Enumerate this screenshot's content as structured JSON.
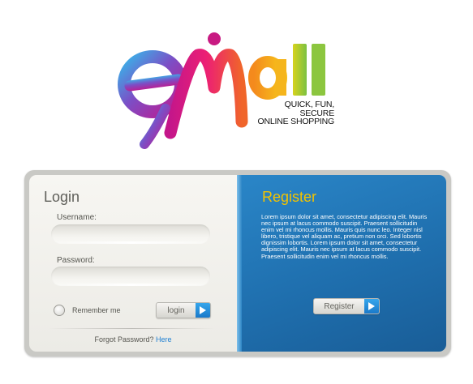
{
  "brand": {
    "logo_text": "emall",
    "tagline": [
      "QUICK, FUN,",
      "SECURE",
      "ONLINE SHOPPING"
    ]
  },
  "login": {
    "title": "Login",
    "username_label": "Username:",
    "username_value": "",
    "password_label": "Password:",
    "password_value": "",
    "remember_label": "Remember me",
    "remember_checked": false,
    "button_label": "login",
    "forgot_text": "Forgot Password?",
    "forgot_link": "Here"
  },
  "register": {
    "title": "Register",
    "description": "Lorem ipsum dolor sit amet, consectetur adipiscing elit. Mauris nec ipsum at lacus commodo suscipit. Praesent sollicitudin enim vel mi rhoncus mollis. Mauris quis nunc leo. Integer nisl libero, tristique vel aliquam ac, pretium non orci. Sed lobortis dignissim lobortis. Lorem ipsum dolor sit amet, consectetur adipiscing elit. Mauris nec ipsum at lacus commodo suscipit. Praesent sollicitudin enim vel mi rhoncus mollis.",
    "button_label": "Register"
  },
  "colors": {
    "register_bg": "#1f6fae",
    "register_title": "#f2c200",
    "link": "#1d7fd2",
    "arrow_button": "#1a79c9"
  },
  "icons": {
    "login_arrow": "play-arrow-icon",
    "register_arrow": "play-arrow-icon"
  }
}
